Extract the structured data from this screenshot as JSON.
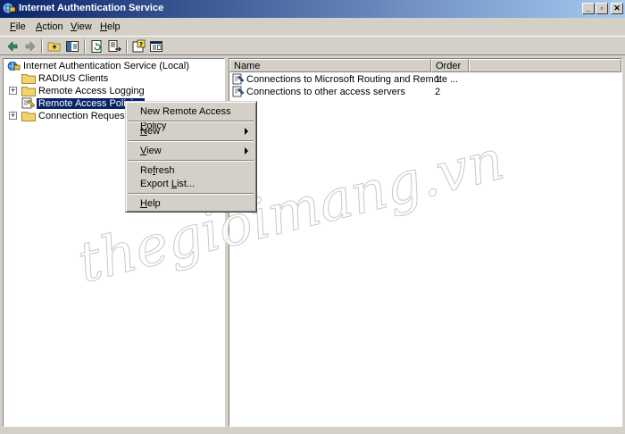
{
  "window": {
    "title": "Internet Authentication Service",
    "minimize": "_",
    "maximize": "▫",
    "close": "✕"
  },
  "menubar": {
    "file": {
      "prefix": "",
      "mnemonic": "F",
      "rest": "ile"
    },
    "action": {
      "prefix": "",
      "mnemonic": "A",
      "rest": "ction"
    },
    "view": {
      "prefix": "",
      "mnemonic": "V",
      "rest": "iew"
    },
    "help": {
      "prefix": "",
      "mnemonic": "H",
      "rest": "elp"
    }
  },
  "toolbar": {
    "icons": [
      "back-arrow-icon",
      "forward-arrow-icon",
      "up-folder-icon",
      "show-hide-tree-icon",
      "refresh-icon",
      "export-list-icon",
      "help-icon",
      "properties-icon"
    ]
  },
  "tree": {
    "root": "Internet Authentication Service (Local)",
    "items": [
      {
        "label": "RADIUS Clients",
        "expander": ""
      },
      {
        "label": "Remote Access Logging",
        "expander": "+"
      },
      {
        "label": "Remote Access Policies",
        "expander": ""
      },
      {
        "label": "Connection Request Pro",
        "expander": "+"
      }
    ]
  },
  "list": {
    "columns": [
      "Name",
      "Order"
    ],
    "rows": [
      {
        "name": "Connections to Microsoft Routing and Remote ...",
        "order": "1"
      },
      {
        "name": "Connections to other access servers",
        "order": "2"
      }
    ]
  },
  "context_menu": {
    "new_policy": {
      "prefix": "New Remote Access ",
      "mnemonic": "P",
      "rest": "olicy"
    },
    "new": {
      "prefix": "",
      "mnemonic": "N",
      "rest": "ew"
    },
    "view": {
      "prefix": "",
      "mnemonic": "V",
      "rest": "iew"
    },
    "refresh": {
      "prefix": "Re",
      "mnemonic": "f",
      "rest": "resh"
    },
    "export": {
      "prefix": "Export ",
      "mnemonic": "L",
      "rest": "ist..."
    },
    "help": {
      "prefix": "",
      "mnemonic": "H",
      "rest": "elp"
    }
  },
  "watermark": "thegioimang.vn",
  "colors": {
    "title_start": "#0a246a",
    "title_end": "#a6caf0",
    "selection": "#0a246a",
    "face": "#d4d0c8"
  }
}
